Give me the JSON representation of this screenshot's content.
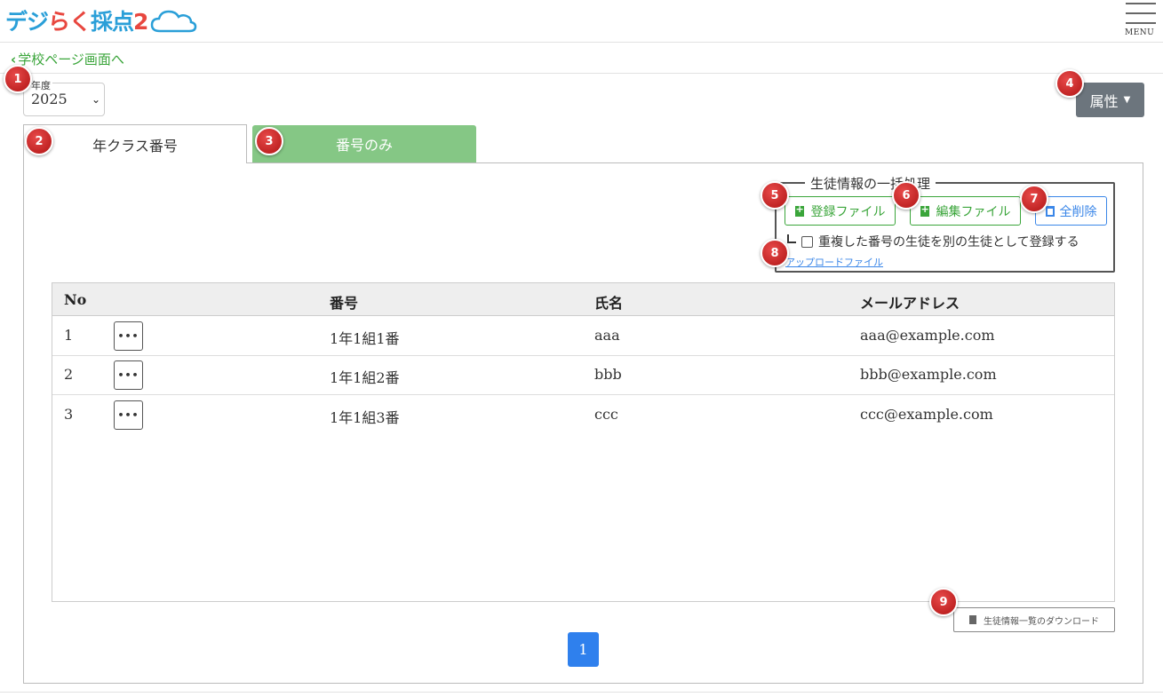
{
  "header": {
    "logo_text": "デジらく採点2",
    "menu_label": "MENU"
  },
  "nav": {
    "back_label": "学校ページ画面へ"
  },
  "year": {
    "legend": "年度",
    "value": "2025"
  },
  "attribute_button": "属性",
  "tabs": [
    {
      "label": "年クラス番号"
    },
    {
      "label": "番号のみ"
    }
  ],
  "bulk": {
    "legend": "生徒情報の一括処理",
    "register_label": "登録ファイル",
    "edit_label": "編集ファイル",
    "delete_all_label": "全削除",
    "duplicate_label": "重複した番号の生徒を別の生徒として登録する",
    "upload_link": "アップロードファイル"
  },
  "table": {
    "headers": {
      "no": "No",
      "number": "番号",
      "name": "氏名",
      "email": "メールアドレス"
    },
    "rows": [
      {
        "no": "1",
        "number": "1年1組1番",
        "name": "aaa",
        "email": "aaa@example.com"
      },
      {
        "no": "2",
        "number": "1年1組2番",
        "name": "bbb",
        "email": "bbb@example.com"
      },
      {
        "no": "3",
        "number": "1年1組3番",
        "name": "ccc",
        "email": "ccc@example.com"
      }
    ],
    "row_menu": "•••"
  },
  "download_button": "生徒情報一覧のダウンロード",
  "pagination": {
    "current": "1"
  },
  "badges": [
    "1",
    "2",
    "3",
    "4",
    "5",
    "6",
    "7",
    "8",
    "9"
  ],
  "colors": {
    "brand_green": "#3aa53a",
    "tab_green": "#85c785",
    "primary_blue": "#2f80ed",
    "attr_gray": "#6c757d",
    "badge_red": "#c41e1e"
  }
}
